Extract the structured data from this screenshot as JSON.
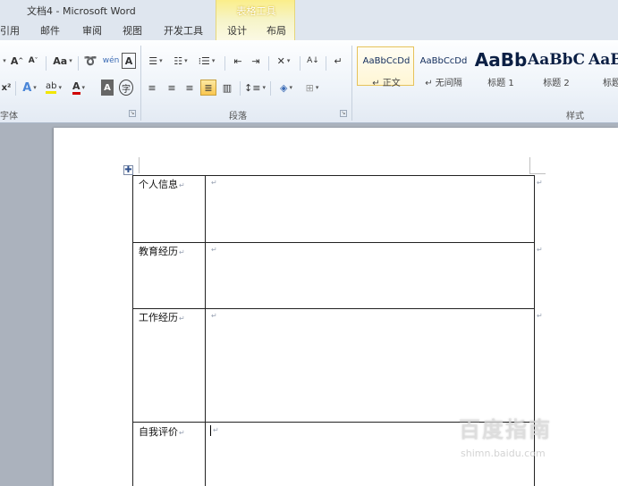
{
  "window": {
    "title": "文档4 - Microsoft Word"
  },
  "context_tab_group": {
    "title": "表格工具"
  },
  "tabs": [
    {
      "label": "引用"
    },
    {
      "label": "邮件"
    },
    {
      "label": "审阅"
    },
    {
      "label": "视图"
    },
    {
      "label": "开发工具"
    },
    {
      "label": "设计"
    },
    {
      "label": "布局"
    }
  ],
  "ribbon": {
    "font_group": {
      "label": "字体",
      "grow_font": "A",
      "shrink_font": "A",
      "change_case": "Aa",
      "phonetic_guide": "wén",
      "char_border": "A",
      "superscript": "x²",
      "text_effects": "A",
      "highlight": "ab",
      "font_color": "A",
      "char_shading": "A",
      "enclose_char": "字"
    },
    "paragraph_group": {
      "label": "段落"
    },
    "styles_group": {
      "label": "样式",
      "styles": [
        {
          "sample": "AaBbCcDd",
          "name": "↵ 正文",
          "selected": true
        },
        {
          "sample": "AaBbCcDd",
          "name": "↵ 无间隔",
          "selected": false
        },
        {
          "sample": "AaBb",
          "name": "标题 1",
          "selected": false
        },
        {
          "sample": "AaBbC",
          "name": "标题 2",
          "selected": false
        },
        {
          "sample": "AaB",
          "name": "标题",
          "selected": false
        }
      ]
    }
  },
  "document": {
    "table": {
      "rows": [
        {
          "label": "个人信息",
          "value": ""
        },
        {
          "label": "教育经历",
          "value": ""
        },
        {
          "label": "工作经历",
          "value": ""
        },
        {
          "label": "自我评价",
          "value": ""
        }
      ]
    },
    "paragraph_mark": "↵"
  },
  "watermark": {
    "text": "百度指南",
    "url": "shimn.baidu.com"
  },
  "colors": {
    "accent_active": "#f9c64f",
    "context_tab": "#fbee8a",
    "ribbon_bg": "#eef3f9"
  }
}
